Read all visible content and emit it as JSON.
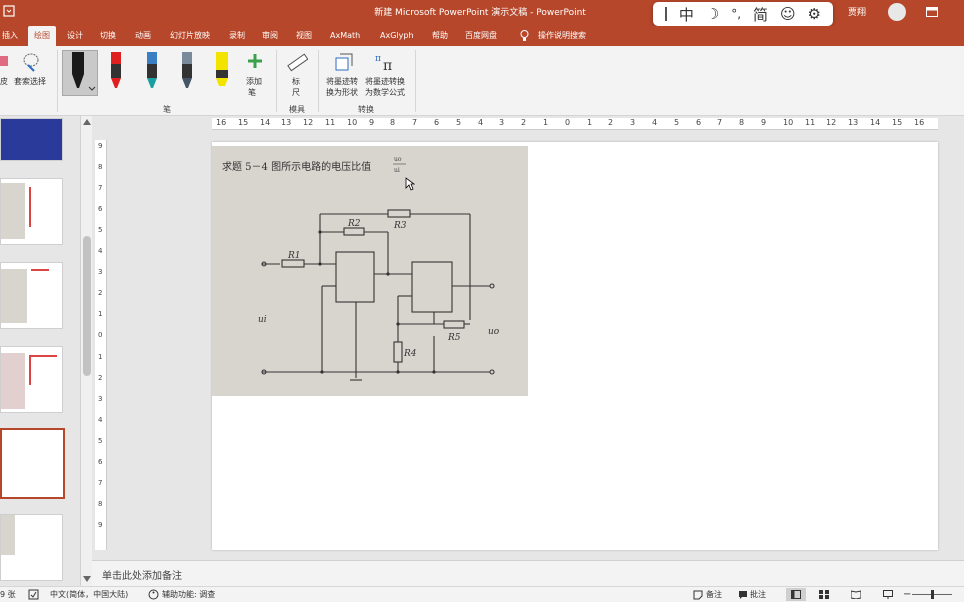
{
  "window": {
    "title": "新建 Microsoft PowerPoint 演示文稿 - PowerPoint",
    "user": "贾翔"
  },
  "ime": {
    "mode_char": "中",
    "simplified_char": "简",
    "moon_glyph": "☽",
    "punct_glyph": "°,",
    "emoji_glyph": "☺",
    "gear_glyph": "⚙"
  },
  "ribbon_tabs": [
    {
      "label": "插入"
    },
    {
      "label": "绘图"
    },
    {
      "label": "设计"
    },
    {
      "label": "切换"
    },
    {
      "label": "动画"
    },
    {
      "label": "幻灯片放映"
    },
    {
      "label": "录制"
    },
    {
      "label": "审阅"
    },
    {
      "label": "视图"
    },
    {
      "label": "AxMath"
    },
    {
      "label": "AxGlyph"
    },
    {
      "label": "帮助"
    },
    {
      "label": "百度网盘"
    },
    {
      "label": "操作说明搜索"
    }
  ],
  "ribbon": {
    "eraser_label": "皮",
    "lasso_label": "套索选择",
    "add_pen_label_1": "添加",
    "add_pen_label_2": "笔",
    "pens_group_label": "笔",
    "ruler_label_1": "标",
    "ruler_label_2": "尺",
    "stencils_group_label": "模具",
    "ink_to_shape_1": "将墨迹转",
    "ink_to_shape_2": "换为形状",
    "ink_to_math_1": "将墨迹转换",
    "ink_to_math_2": "为数学公式",
    "convert_group_label": "转换"
  },
  "ruler": {
    "h_ticks": [
      "16",
      "15",
      "14",
      "13",
      "12",
      "11",
      "10",
      "9",
      "8",
      "7",
      "6",
      "5",
      "4",
      "3",
      "2",
      "1",
      "0",
      "1",
      "2",
      "3",
      "4",
      "5",
      "6",
      "7",
      "8",
      "9",
      "10",
      "11",
      "12",
      "13",
      "14",
      "15",
      "16"
    ],
    "v_ticks": [
      "9",
      "8",
      "7",
      "6",
      "5",
      "4",
      "3",
      "2",
      "1",
      "0",
      "1",
      "2",
      "3",
      "4",
      "5",
      "6",
      "7",
      "8",
      "9"
    ]
  },
  "slide": {
    "question_text": "求题 5－4 图所示电路的电压比值",
    "label_R1": "R1",
    "label_R2": "R2",
    "label_R3": "R3",
    "label_R4": "R4",
    "label_R5": "R5",
    "label_ui": "ui",
    "label_uo": "uo"
  },
  "notes": {
    "placeholder": "单击此处添加备注"
  },
  "status": {
    "slide_count": "9 张",
    "language": "中文(简体，中国大陆)",
    "accessibility": "辅助功能: 调查",
    "notes_btn": "备注",
    "comments_btn": "批注"
  },
  "colors": {
    "accent": "#b7472a"
  }
}
